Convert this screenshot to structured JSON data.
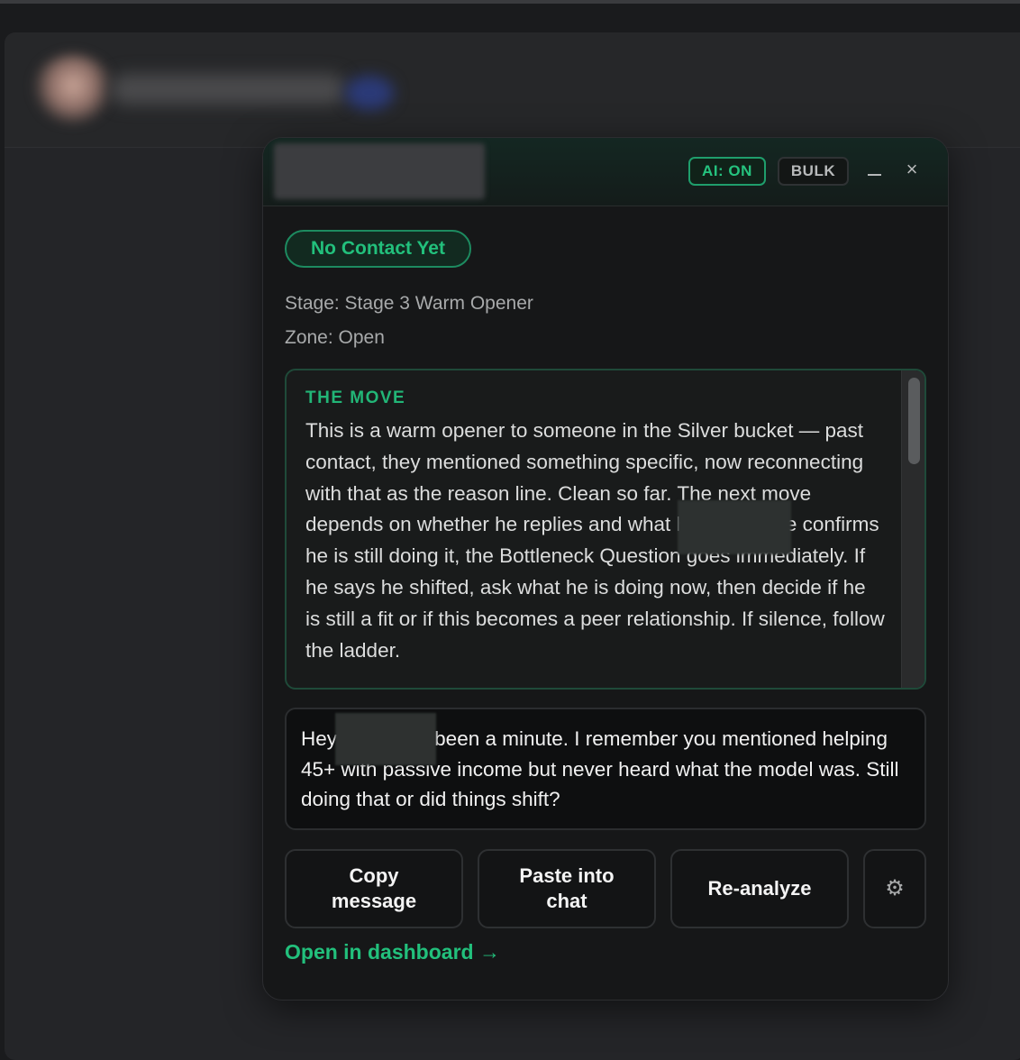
{
  "panel": {
    "ai_toggle": "AI: ON",
    "bulk_label": "BULK",
    "status": "No Contact Yet",
    "stage": "Stage: Stage 3 Warm Opener",
    "zone": "Zone: Open",
    "move": {
      "title": "THE MOVE",
      "text": "This is a warm opener to someone in the Silver bucket — past contact, they mentioned something specific, now reconnecting with that as the reason line. Clean so far. The next move depends on whether he replies and what he says. If he confirms he is still doing it, the Bottleneck Question goes immediately. If he says he shifted, ask what he is doing now, then decide if he is still a fit or if this becomes a peer relationship. If silence, follow the ladder."
    },
    "message": "Hey ▒▒▒▒▒▒ been a minute. I remember you mentioned helping 45+ with passive income but never heard what the model was. Still doing that or did things shift?",
    "actions": {
      "copy": "Copy message",
      "paste": "Paste into chat",
      "reanalyze": "Re-analyze",
      "settings_icon": "⚙"
    },
    "dashboard_link": "Open in dashboard →"
  },
  "icons": {
    "minimize": "minimize-icon",
    "close": "×"
  },
  "colors": {
    "accent": "#22c07c",
    "panel_bg": "#161718",
    "page_bg": "#1a1b1d"
  }
}
